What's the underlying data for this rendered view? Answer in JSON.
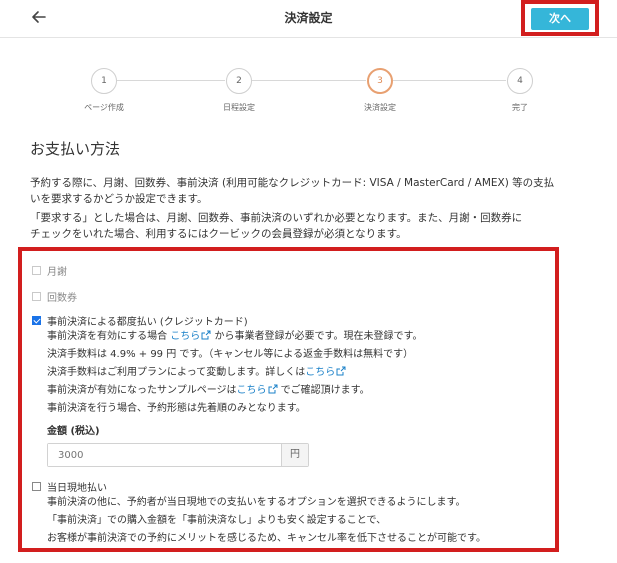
{
  "header": {
    "title": "決済設定",
    "next_label": "次へ"
  },
  "stepper": {
    "steps": [
      {
        "number": "1",
        "label": "ページ作成"
      },
      {
        "number": "2",
        "label": "日程設定"
      },
      {
        "number": "3",
        "label": "決済設定"
      },
      {
        "number": "4",
        "label": "完了"
      }
    ],
    "active_step": 3
  },
  "section": {
    "title": "お支払い方法",
    "desc1_line1": "予約する際に、月謝、回数券、事前決済 (利用可能なクレジットカード: VISA / MasterCard / AMEX) 等の支払",
    "desc1_line2": "いを要求するかどうか設定できます。",
    "desc2_line1": "「要求する」とした場合は、月謝、回数券、事前決済のいずれか必要となります。また、月謝・回数券に",
    "desc2_line2": "チェックをいれた場合、利用するにはクービックの会員登録が必須となります。"
  },
  "options": {
    "monthly": {
      "label": "月謝",
      "checked": false,
      "disabled": true
    },
    "coupon": {
      "label": "回数券",
      "checked": false,
      "disabled": true
    },
    "prepay": {
      "label": "事前決済による都度払い (クレジットカード)",
      "checked": true,
      "line1_a": "事前決済を有効にする場合 ",
      "line1_link": "こちら",
      "line1_b": " から事業者登録が必要です。現在未登録です。",
      "line2": "決済手数料は 4.9% + 99 円 です。（キャンセル等による返金手数料は無料です）",
      "line3_a": "決済手数料はご利用プランによって変動します。詳しくは",
      "line3_link": "こちら",
      "line4_a": "事前決済が有効になったサンプルページは",
      "line4_link": "こちら",
      "line4_b": " でご確認頂けます。",
      "line5": "事前決済を行う場合、予約形態は先着順のみとなります。",
      "amount_label": "金額 (税込)",
      "amount_placeholder": "3000",
      "amount_unit": "円"
    },
    "onsite": {
      "label": "当日現地払い",
      "checked": false,
      "line1": "事前決済の他に、予約者が当日現地での支払いをするオプションを選択できるようにします。",
      "line2": "「事前決済」での購入金額を「事前決済なし」よりも安く設定することで、",
      "line3": "お客様が事前決済での予約にメリットを感じるため、キャンセル率を低下させることが可能です。"
    }
  },
  "colors": {
    "accent": "#35b6d9",
    "highlight_border": "#d21e1e",
    "active_step": "#e8a071",
    "link": "#1a80c8"
  }
}
